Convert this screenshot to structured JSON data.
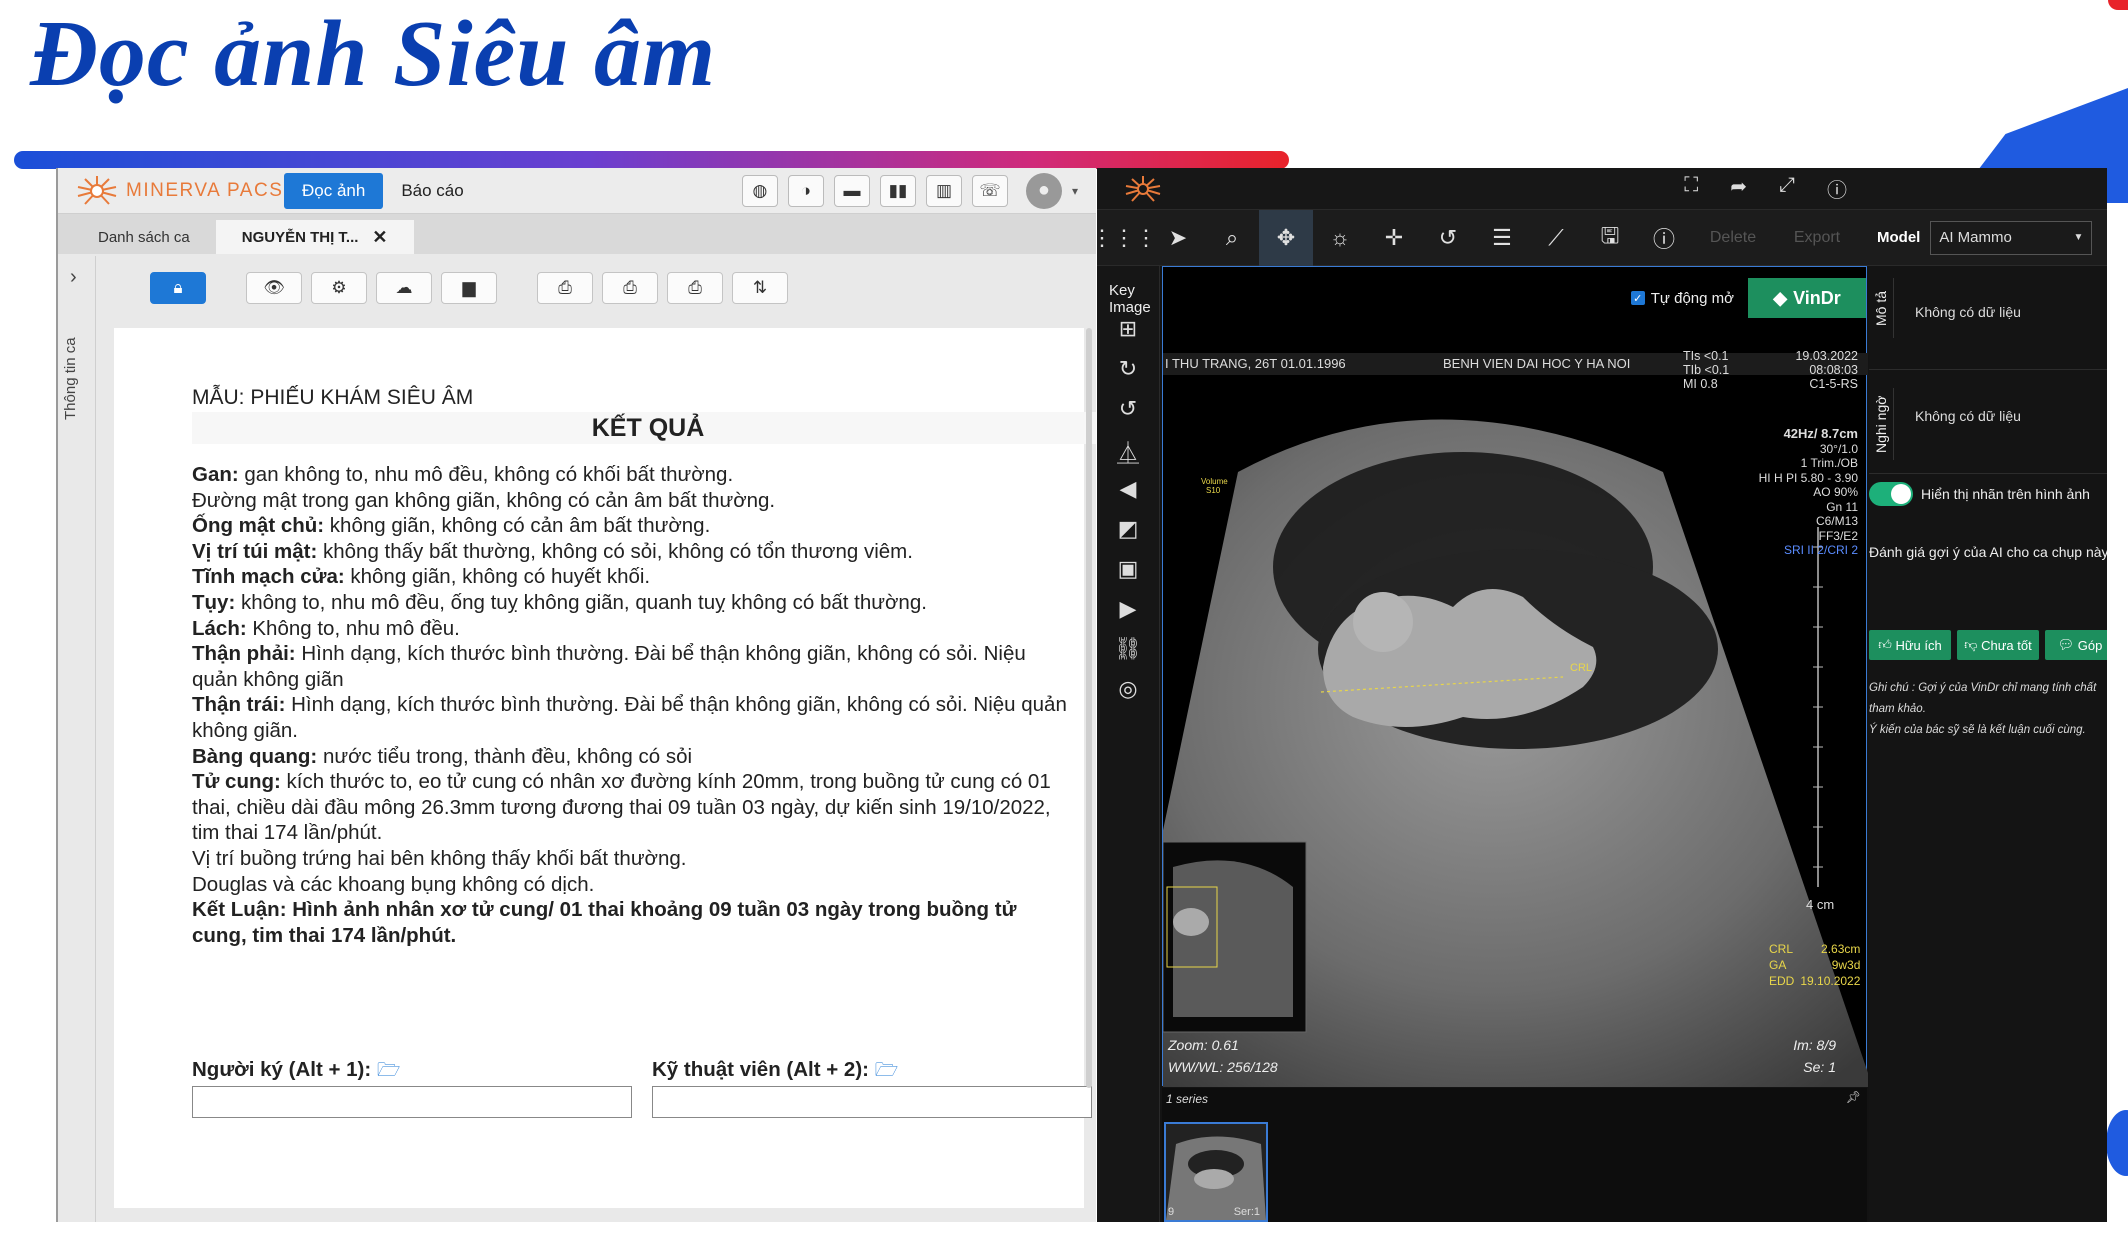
{
  "slide": {
    "title": "Đọc ảnh Siêu âm"
  },
  "pacs": {
    "brand": "MINERVA PACS",
    "nav": [
      {
        "label": "Đọc ảnh"
      },
      {
        "label": "Báo cáo"
      }
    ],
    "tabs": [
      {
        "label": "Danh sách ca"
      },
      {
        "label": "NGUYỄN THỊ T..."
      }
    ],
    "tab_close": "✕",
    "sidebar_label": "Thông tin ca",
    "report": {
      "template_label": "MẪU: PHIẾU KHÁM SIÊU ÂM",
      "heading": "KẾT QUẢ",
      "lines": [
        {
          "b": "Gan:",
          "t": " gan không to, nhu mô đều, không có khối bất thường."
        },
        {
          "b": "",
          "t": "Đường mật trong gan không giãn, không có cản âm bất thường."
        },
        {
          "b": "Ống mật chủ:",
          "t": " không giãn, không có cản âm bất thường."
        },
        {
          "b": "Vị trí túi mật:",
          "t": " không thấy bất thường, không có sỏi, không có tổn thương viêm."
        },
        {
          "b": "Tĩnh mạch cửa:",
          "t": " không giãn, không có huyết khối."
        },
        {
          "b": "Tụy:",
          "t": " không to, nhu mô đều, ống tuỵ không giãn, quanh tuỵ không có bất thường."
        },
        {
          "b": "Lách:",
          "t": " Không to, nhu mô đều."
        },
        {
          "b": "Thận phải:",
          "t": " Hình dạng, kích thước bình thường. Đài bể thận không giãn, không có sỏi. Niệu quản không giãn"
        },
        {
          "b": "Thận trái:",
          "t": " Hình dạng, kích thước bình thường. Đài bể thận không giãn, không có sỏi. Niệu quản không giãn."
        },
        {
          "b": "Bàng quang:",
          "t": " nước tiểu trong, thành đều, không có sỏi"
        },
        {
          "b": "Tử cung:",
          "t": " kích thước to, eo tử cung có nhân xơ đường kính 20mm, trong buồng tử cung có 01 thai, chiều dài đầu mông 26.3mm tương đương thai 09 tuần 03 ngày, dự kiến sinh 19/10/2022, tim thai 174 lần/phút."
        },
        {
          "b": "",
          "t": "Vị trí buồng trứng hai bên không thấy khối bất thường."
        },
        {
          "b": "",
          "t": "Douglas và các khoang bụng không có dịch."
        },
        {
          "b": "Kết Luận: Hình ảnh nhân xơ tử cung/ 01 thai khoảng 09 tuần 03 ngày trong buồng tử cung, tim thai 174 lần/phút.",
          "t": ""
        }
      ],
      "signer_label": "Người ký (Alt + 1):",
      "tech_label": "Kỹ thuật viên (Alt + 2):"
    }
  },
  "viewer": {
    "top_icons": [
      "fullscreen-icon",
      "share-icon",
      "expand-icon",
      "info-icon"
    ],
    "toolbar_dim": [
      "Delete",
      "Export"
    ],
    "model_label": "Model",
    "model_value": "AI Mammo",
    "key_image": "Key Image",
    "auto_open": "Tự động mở",
    "vindr": "VinDr",
    "us": {
      "patient": "I THU TRANG,  26T  01.01.1996",
      "hospital": "BENH VIEN DAI HOC Y HA NOI",
      "tis": "TIs <0.1",
      "tib": "TIb <0.1",
      "mi": "MI  0.8",
      "date": "19.03.2022",
      "time": "08:08:03",
      "probe": "C1-5-RS",
      "params": [
        "42Hz/ 8.7cm",
        "30°/1.0",
        "1 Trim./OB",
        "HI H PI 5.80 - 3.90",
        "AO 90%",
        "Gn 11",
        "C6/M13",
        "FF3/E2",
        "SRI II 2/CRI 2"
      ],
      "depth": "4 cm",
      "volume": "Volume\nS10",
      "meas": [
        {
          "k": "CRL",
          "v": "2.63cm"
        },
        {
          "k": "GA",
          "v": "9w3d"
        },
        {
          "k": "EDD",
          "v": "19.10.2022"
        }
      ],
      "crl_tag": "CRL",
      "zoom": "Zoom: 0.61",
      "wwwl": "WW/WL: 256/128",
      "im": "Im: 8/9",
      "se": "Se: 1"
    },
    "series_label": "1 series",
    "thumb_num": "9",
    "thumb_ser": "Ser:1",
    "ai": {
      "desc_label": "Mô tả",
      "desc_value": "Không có dữ liệu",
      "sus_label": "Nghi ngờ",
      "sus_value": "Không có dữ liệu",
      "toggle_label": "Hiển thị nhãn trên hình ảnh",
      "eval_text": "Đánh giá gợi ý của AI cho ca chụp này",
      "btn_useful": "Hữu ích",
      "btn_notgood": "Chưa tốt",
      "btn_feedback": "Góp",
      "note1": "Ghi chú : Gợi ý của VinDr chỉ mang tính chất tham khảo.",
      "note2": "Ý kiến của bác sỹ sẽ là kết luận cuối cùng."
    }
  },
  "colors": {
    "title": "#0a3fb0",
    "accent": "#1e78d6",
    "ai_green": "#1d8f5e",
    "brand_orange": "#e87a3a"
  }
}
